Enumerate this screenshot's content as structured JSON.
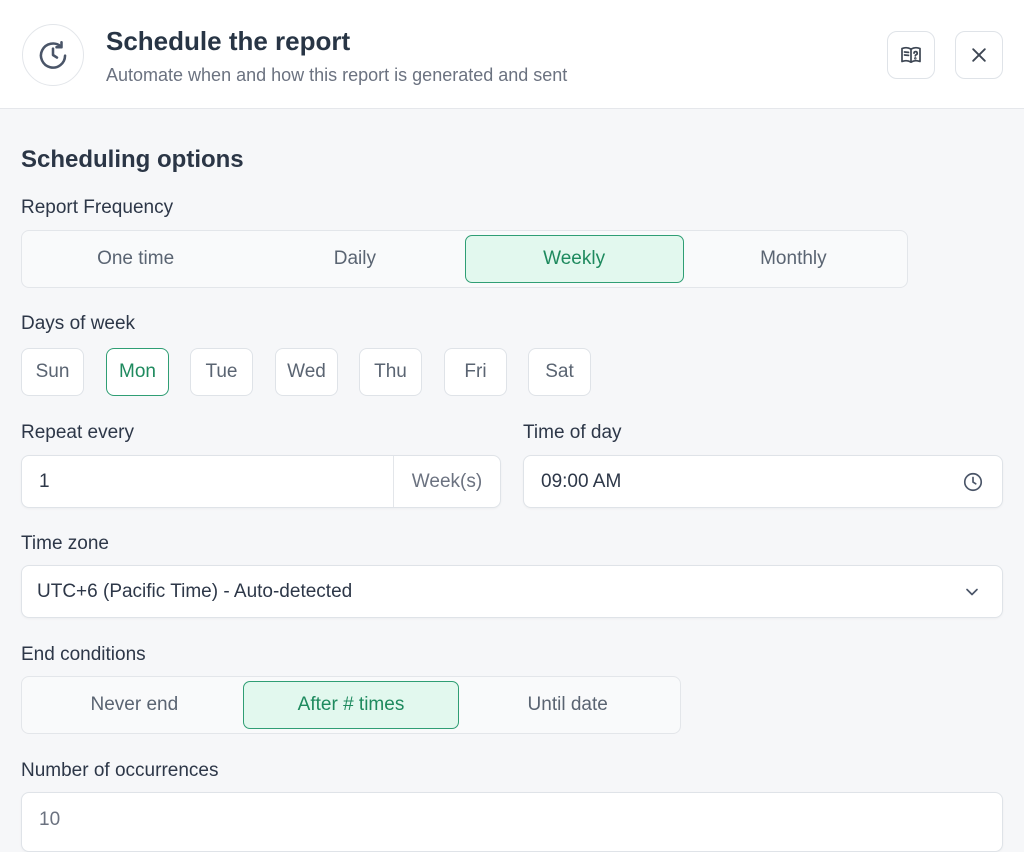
{
  "header": {
    "title": "Schedule the report",
    "subtitle": "Automate when and how this report is generated and sent",
    "icon": "clock-refresh-icon",
    "help_icon": "book-help-icon",
    "close_icon": "close-icon"
  },
  "section": {
    "title": "Scheduling options"
  },
  "frequency": {
    "label": "Report Frequency",
    "options": [
      "One time",
      "Daily",
      "Weekly",
      "Monthly"
    ],
    "selected": "Weekly"
  },
  "days": {
    "label": "Days of week",
    "options": [
      "Sun",
      "Mon",
      "Tue",
      "Wed",
      "Thu",
      "Fri",
      "Sat"
    ],
    "selected": [
      "Mon"
    ]
  },
  "repeat": {
    "label": "Repeat every",
    "value": "1",
    "unit": "Week(s)"
  },
  "time": {
    "label": "Time of day",
    "value": "09:00 AM",
    "icon": "clock-icon"
  },
  "timezone": {
    "label": "Time zone",
    "value": "UTC+6 (Pacific Time) - Auto-detected",
    "icon": "chevron-down-icon"
  },
  "end": {
    "label": "End conditions",
    "options": [
      "Never end",
      "After # times",
      "Until date"
    ],
    "selected": "After # times"
  },
  "occurrences": {
    "label": "Number of occurrences",
    "value": "10"
  },
  "colors": {
    "accent": "#2f9e74",
    "accent_bg": "#e2f8ee",
    "text": "#2d3748"
  }
}
